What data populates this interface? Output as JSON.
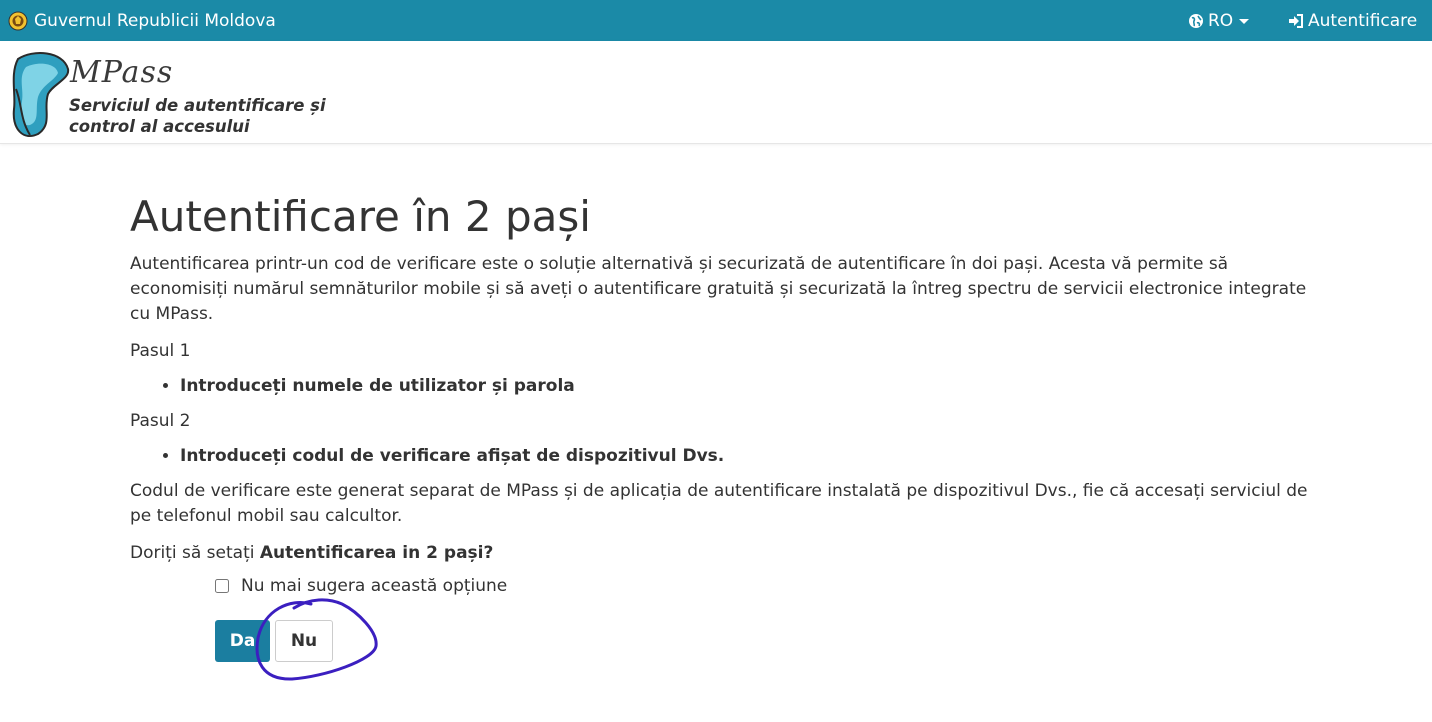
{
  "topbar": {
    "gov_name": "Guvernul Republicii Moldova",
    "lang_label": "RO",
    "login_label": "Autentificare",
    "background_color": "#1b8aa7"
  },
  "header": {
    "logo_name": "MPass",
    "logo_tagline_line1": "Serviciul de autentificare și",
    "logo_tagline_line2": "control al accesului"
  },
  "main": {
    "title": "Autentificare în 2 pași",
    "intro": "Autentificarea printr-un cod de verificare este o soluție alternativă și securizată de autentificare în doi pași. Acesta vă permite să economisiți numărul semnăturilor mobile și să aveți o autentificare gratuită și securizată la întreg spectru de servicii electronice integrate cu MPass.",
    "step1_label": "Pasul 1",
    "step1_item": "Introduceți numele de utilizator și parola",
    "step2_label": "Pasul 2",
    "step2_item": "Introduceți codul de verificare afișat de dispozitivul Dvs.",
    "note": "Codul de verificare este generat separat de MPass și de aplicația de autentificare instalată pe dispozitivul Dvs., fie că accesați serviciul de pe telefonul mobil sau calcultor.",
    "question_prefix": "Doriți să setați ",
    "question_emphasis": "Autentificarea in 2 pași?",
    "dont_suggest_label": "Nu mai sugera această opțiune",
    "dont_suggest_checked": false,
    "yes_button": "Da",
    "no_button": "Nu",
    "primary_color": "#1b7ea0"
  },
  "annotation": {
    "color": "#3b1fc0"
  }
}
